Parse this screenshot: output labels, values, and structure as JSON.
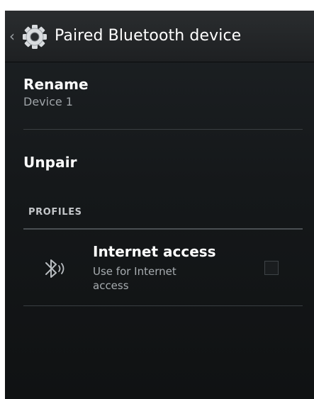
{
  "action_bar": {
    "title": "Paired Bluetooth device",
    "up_glyph": "‹",
    "icon": "settings-gear-icon"
  },
  "rename": {
    "title": "Rename",
    "summary": "Device 1"
  },
  "unpair": {
    "title": "Unpair"
  },
  "profiles": {
    "header": "PROFILES",
    "items": [
      {
        "title": "Internet access",
        "summary": "Use for Internet access",
        "checked": false,
        "icon": "bluetooth-icon"
      }
    ]
  },
  "colors": {
    "background": "#15181a",
    "action_bar": "#25282a",
    "text_primary": "#ffffff",
    "text_secondary": "#9ea3a7",
    "divider": "#3a3f43"
  }
}
